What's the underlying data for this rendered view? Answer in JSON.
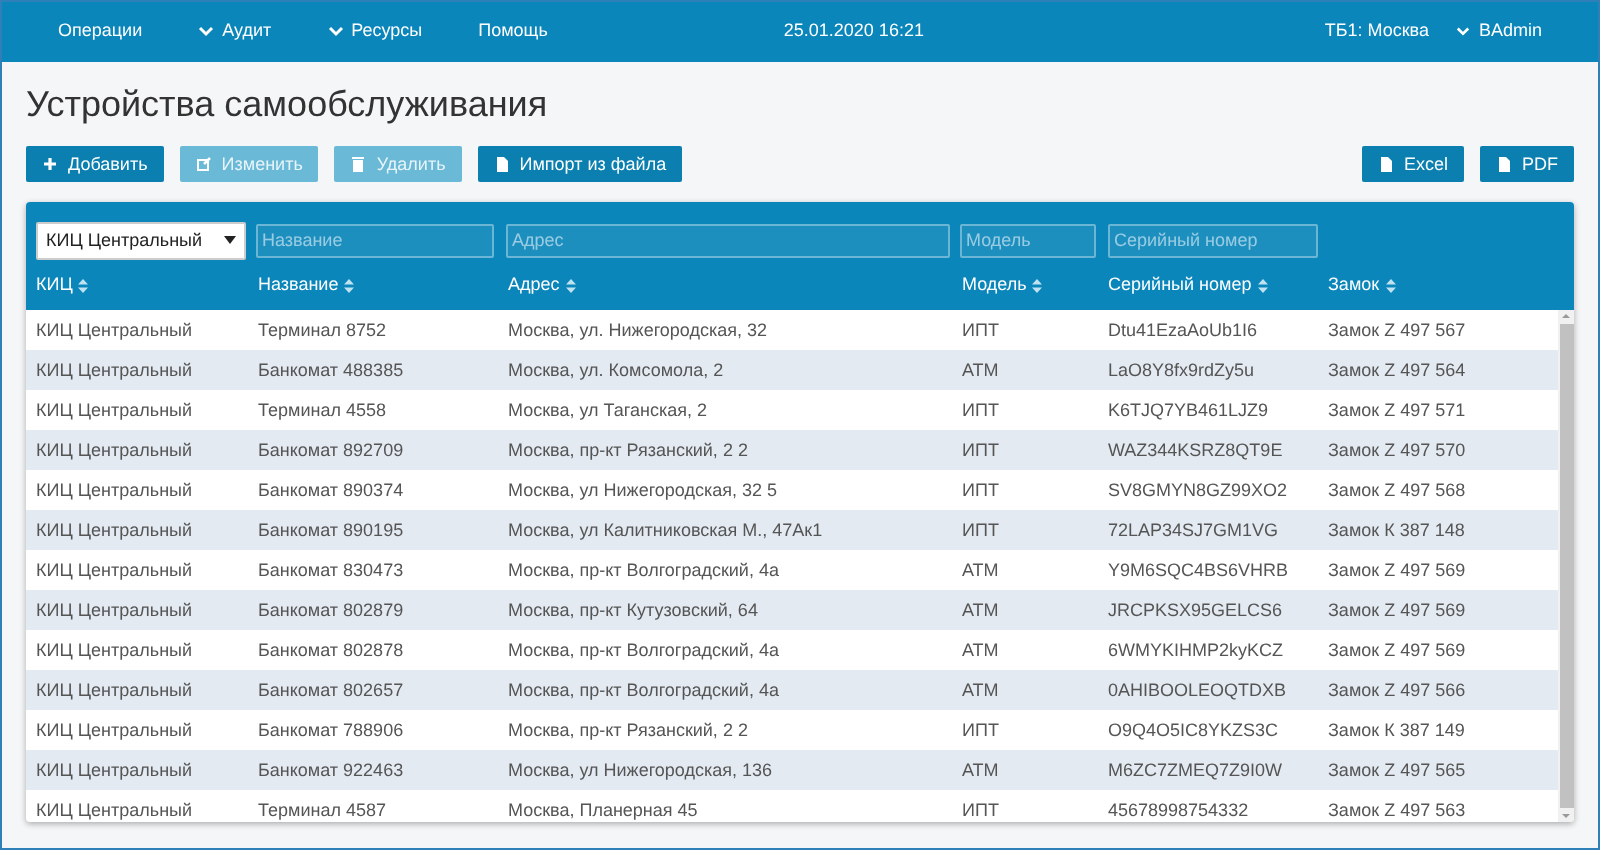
{
  "nav": {
    "menu": [
      {
        "label": "Операции",
        "dropdown": false
      },
      {
        "label": "Аудит",
        "dropdown": true
      },
      {
        "label": "Ресурсы",
        "dropdown": true
      },
      {
        "label": "Помощь",
        "dropdown": false
      }
    ],
    "datetime": "25.01.2020 16:21",
    "branch": "ТБ1: Москва",
    "user": "BAdmin"
  },
  "title": "Устройства самообслуживания",
  "toolbar": [
    {
      "label": "Добавить",
      "disabled": false
    },
    {
      "label": "Изменить",
      "disabled": true
    },
    {
      "label": "Удалить",
      "disabled": true
    },
    {
      "label": "Импорт из файла",
      "disabled": false
    }
  ],
  "exports": [
    {
      "label": "Excel"
    },
    {
      "label": "PDF"
    }
  ],
  "filters": [
    {
      "kind": "select",
      "value": "КИЦ Центральный"
    },
    {
      "kind": "input",
      "placeholder": "Название"
    },
    {
      "kind": "input",
      "placeholder": "Адрес"
    },
    {
      "kind": "input",
      "placeholder": "Модель"
    },
    {
      "kind": "input",
      "placeholder": "Серийный номер"
    }
  ],
  "columns": [
    "КИЦ",
    "Название",
    "Адрес",
    "Модель",
    "Серийный номер",
    "Замок"
  ],
  "rows": [
    [
      "КИЦ Центральный",
      "Терминал 8752",
      "Москва, ул. Нижегородская, 32",
      "ИПТ",
      "Dtu41EzaAoUb1I6",
      "Замок Z 497 567"
    ],
    [
      "КИЦ Центральный",
      "Банкомат 488385",
      "Москва, ул. Комсомола, 2",
      "АТМ",
      "LaO8Y8fx9rdZy5u",
      "Замок Z 497 564"
    ],
    [
      "КИЦ Центральный",
      "Терминал 4558",
      "Москва, ул Таганская, 2",
      "ИПТ",
      "K6TJQ7YB461LJZ9",
      "Замок Z 497 571"
    ],
    [
      "КИЦ Центральный",
      "Банкомат 892709",
      "Москва, пр-кт Рязанский, 2 2",
      "ИПТ",
      "WAZ344KSRZ8QT9E",
      "Замок Z 497 570"
    ],
    [
      "КИЦ Центральный",
      "Банкомат 890374",
      "Москва, ул Нижегородская, 32 5",
      "ИПТ",
      "SV8GMYN8GZ99XO2",
      "Замок Z 497 568"
    ],
    [
      "КИЦ Центральный",
      "Банкомат 890195",
      "Москва, ул Калитниковская М., 47Ак1",
      "ИПТ",
      "72LAP34SJ7GM1VG",
      "Замок К 387 148"
    ],
    [
      "КИЦ Центральный",
      "Банкомат 830473",
      "Москва, пр-кт Волгоградский, 4а",
      "АТМ",
      "Y9M6SQC4BS6VHRB",
      "Замок Z 497 569"
    ],
    [
      "КИЦ Центральный",
      "Банкомат 802879",
      "Москва, пр-кт Кутузовский, 64",
      "АТМ",
      "JRCPKSX95GELCS6",
      "Замок Z 497 569"
    ],
    [
      "КИЦ Центральный",
      "Банкомат 802878",
      "Москва, пр-кт Волгоградский, 4а",
      "АТМ",
      "6WMYKIHMP2kyKCZ",
      "Замок Z 497 569"
    ],
    [
      "КИЦ Центральный",
      "Банкомат 802657",
      "Москва, пр-кт Волгоградский, 4а",
      "АТМ",
      "0AHIBOOLEOQTDXB",
      "Замок Z 497 566"
    ],
    [
      "КИЦ Центральный",
      "Банкомат 788906",
      "Москва, пр-кт Рязанский, 2 2",
      "ИПТ",
      "O9Q4O5IC8YKZS3C",
      "Замок К 387 149"
    ],
    [
      "КИЦ Центральный",
      "Банкомат 922463",
      "Москва, ул Нижегородская, 136",
      "АТМ",
      "M6ZC7ZMEQ7Z9I0W",
      "Замок Z 497 565"
    ],
    [
      "КИЦ Центральный",
      "Терминал 4587",
      "Москва, Планерная 45",
      "ИПТ",
      "45678998754332",
      "Замок Z 497 563"
    ]
  ]
}
